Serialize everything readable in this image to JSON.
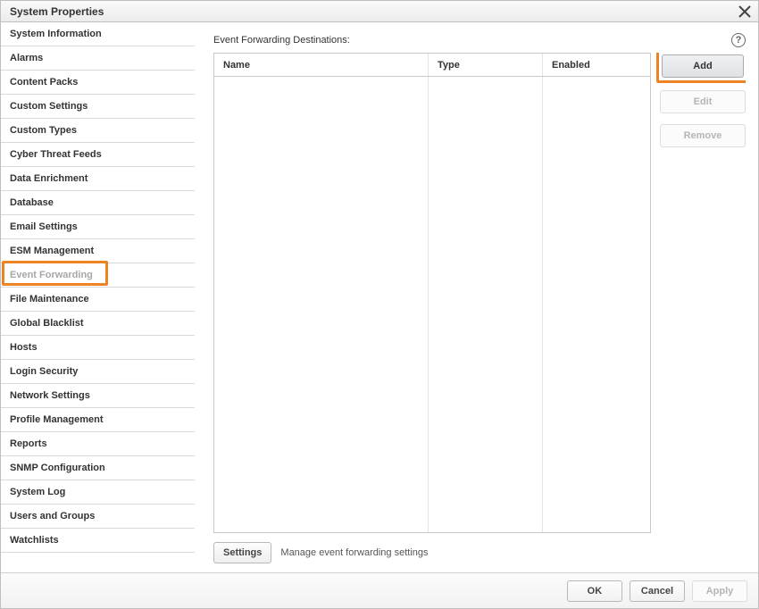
{
  "title": "System Properties",
  "sidebar": {
    "items": [
      {
        "label": "System Information"
      },
      {
        "label": "Alarms"
      },
      {
        "label": "Content Packs"
      },
      {
        "label": "Custom Settings"
      },
      {
        "label": "Custom Types"
      },
      {
        "label": "Cyber Threat Feeds"
      },
      {
        "label": "Data Enrichment"
      },
      {
        "label": "Database"
      },
      {
        "label": "Email Settings"
      },
      {
        "label": "ESM Management"
      },
      {
        "label": "Event Forwarding",
        "selected": true
      },
      {
        "label": "File Maintenance"
      },
      {
        "label": "Global Blacklist"
      },
      {
        "label": "Hosts"
      },
      {
        "label": "Login Security"
      },
      {
        "label": "Network Settings"
      },
      {
        "label": "Profile Management"
      },
      {
        "label": "Reports"
      },
      {
        "label": "SNMP Configuration"
      },
      {
        "label": "System Log"
      },
      {
        "label": "Users and Groups"
      },
      {
        "label": "Watchlists"
      }
    ]
  },
  "main": {
    "section_title": "Event Forwarding Destinations:",
    "columns": {
      "name": "Name",
      "type": "Type",
      "enabled": "Enabled"
    },
    "rows": [],
    "buttons": {
      "add": "Add",
      "edit": "Edit",
      "remove": "Remove"
    },
    "settings_button": "Settings",
    "settings_desc": "Manage event forwarding settings"
  },
  "footer": {
    "ok": "OK",
    "cancel": "Cancel",
    "apply": "Apply"
  }
}
